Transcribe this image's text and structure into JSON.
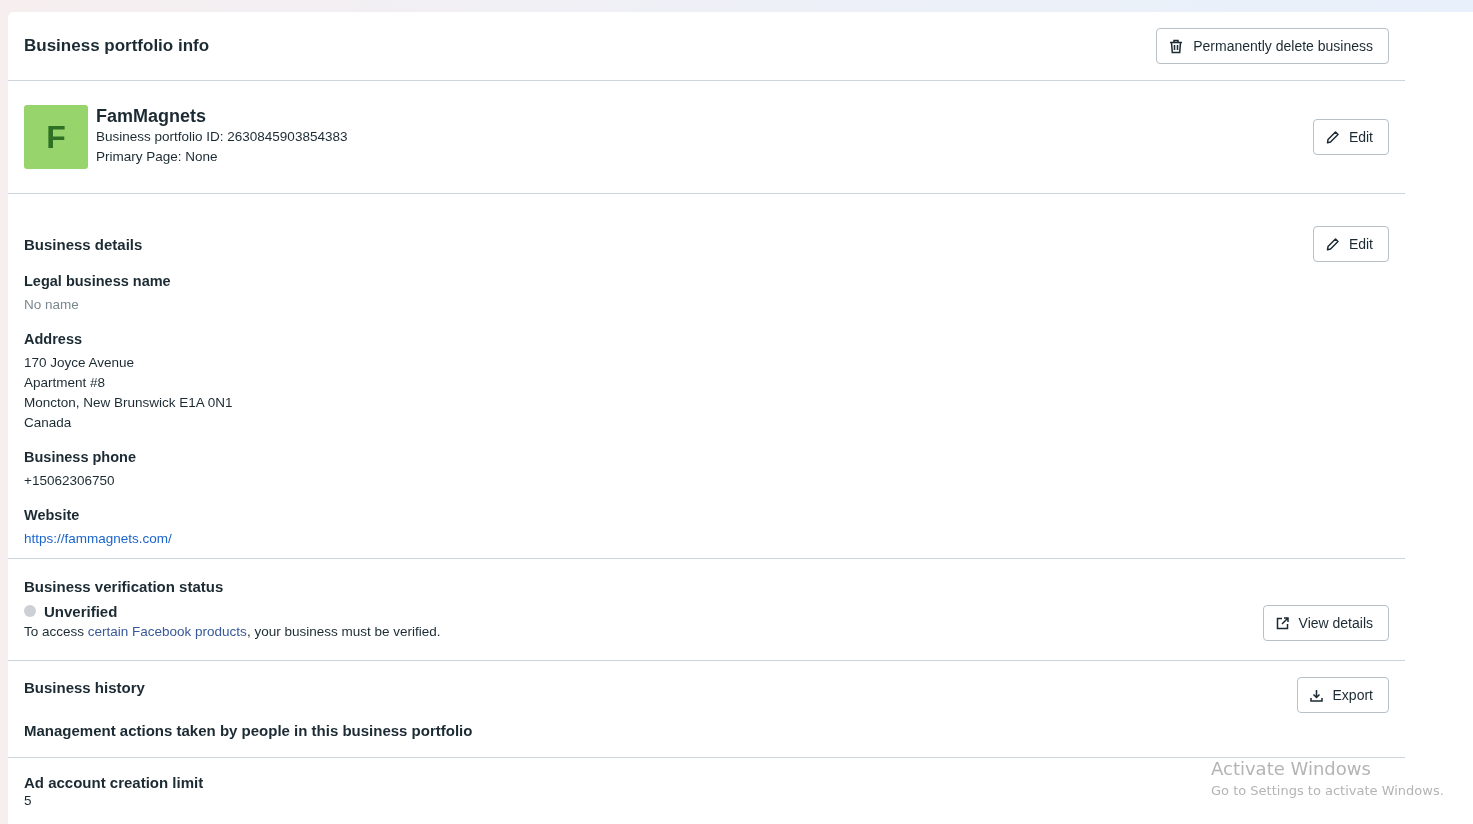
{
  "header": {
    "title": "Business portfolio info",
    "delete_button": "Permanently delete business"
  },
  "profile": {
    "initial": "F",
    "name": "FamMagnets",
    "lines": [
      "Business portfolio ID: 2630845903854383",
      "Primary Page: None"
    ],
    "edit_button": "Edit"
  },
  "business_details": {
    "title": "Business details",
    "edit_button": "Edit",
    "fields": [
      {
        "label": "Legal business name",
        "kind": "placeholder",
        "lines": [
          "No name"
        ]
      },
      {
        "label": "Address",
        "kind": "text",
        "lines": [
          "170 Joyce Avenue",
          "Apartment #8",
          "Moncton, New Brunswick E1A 0N1",
          "Canada"
        ]
      },
      {
        "label": "Business phone",
        "kind": "text",
        "lines": [
          "+15062306750"
        ]
      },
      {
        "label": "Website",
        "kind": "link",
        "lines": [
          "https://fammagnets.com/"
        ]
      }
    ]
  },
  "verification": {
    "title": "Business verification status",
    "status": {
      "label": "Unverified",
      "verified": false
    },
    "note": {
      "before": "To access ",
      "link": "certain Facebook products",
      "after": ", your business must be verified."
    },
    "button": "View details"
  },
  "history": {
    "title": "Business history",
    "subtitle": "Management actions taken by people in this business portfolio",
    "button": "Export"
  },
  "ad_limit": {
    "title": "Ad account creation limit",
    "value": "5"
  },
  "os_notice": {
    "title": "Activate Windows",
    "message": "Go to Settings to activate Windows."
  }
}
